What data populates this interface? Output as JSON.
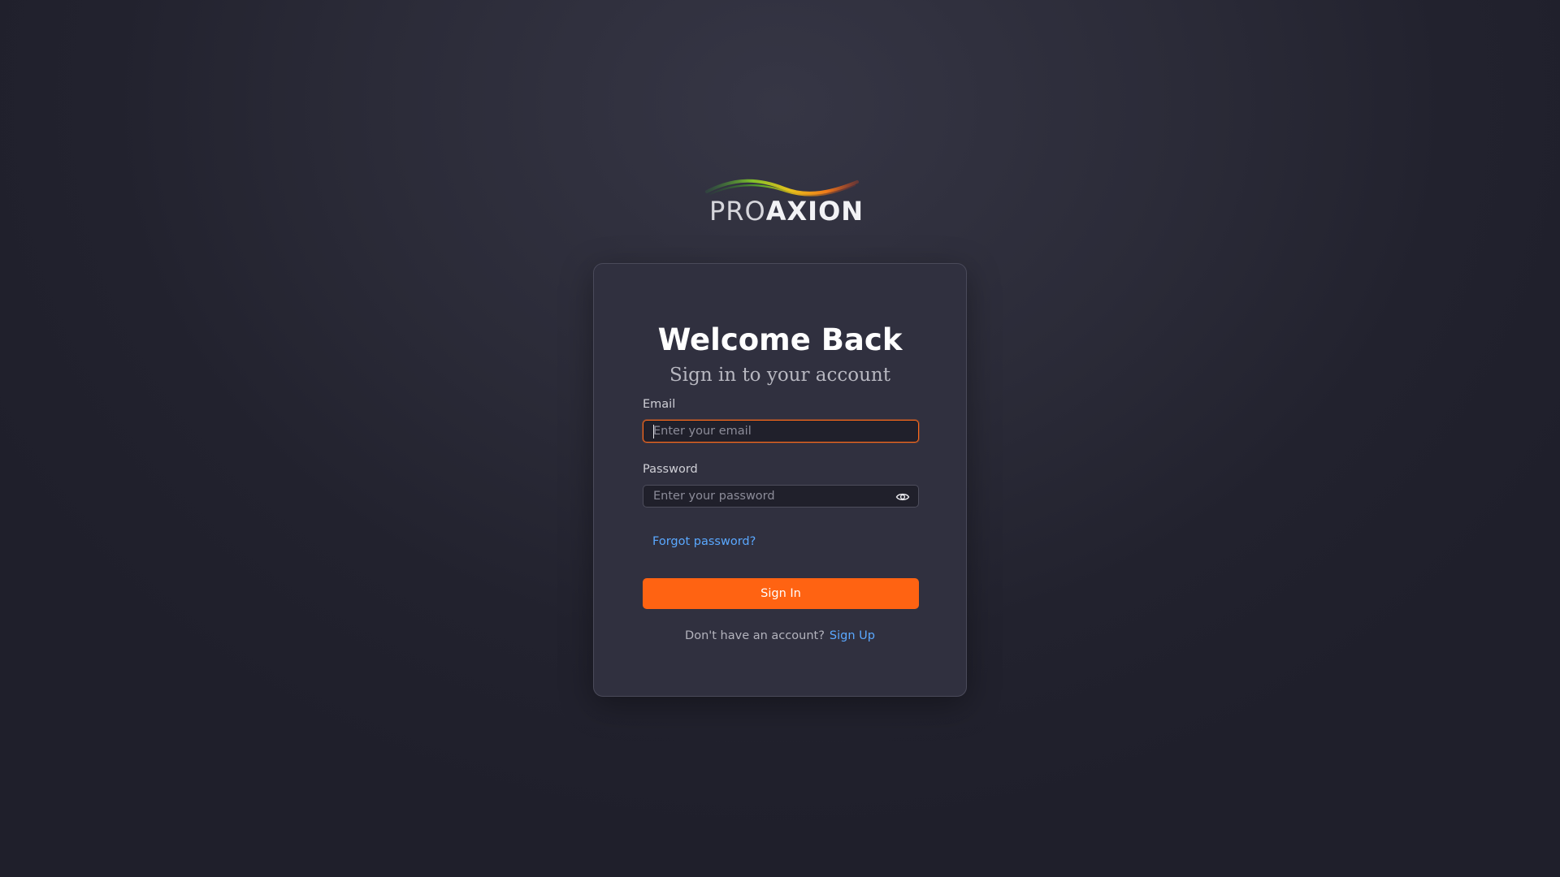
{
  "brand": {
    "logo_light": "PRO",
    "logo_bold": "AXION",
    "accent_color": "#ff6312",
    "link_color": "#5aa8ff"
  },
  "login": {
    "title": "Welcome Back",
    "subtitle": "Sign in to your account",
    "email_label": "Email",
    "email_value": "",
    "email_placeholder": "Enter your email",
    "password_label": "Password",
    "password_value": "",
    "password_placeholder": "Enter your password",
    "password_toggle_icon": "eye-icon",
    "forgot_link": "Forgot password?",
    "signin_button": "Sign In",
    "signup_prompt": "Don't have an account?",
    "signup_link": "Sign Up"
  }
}
